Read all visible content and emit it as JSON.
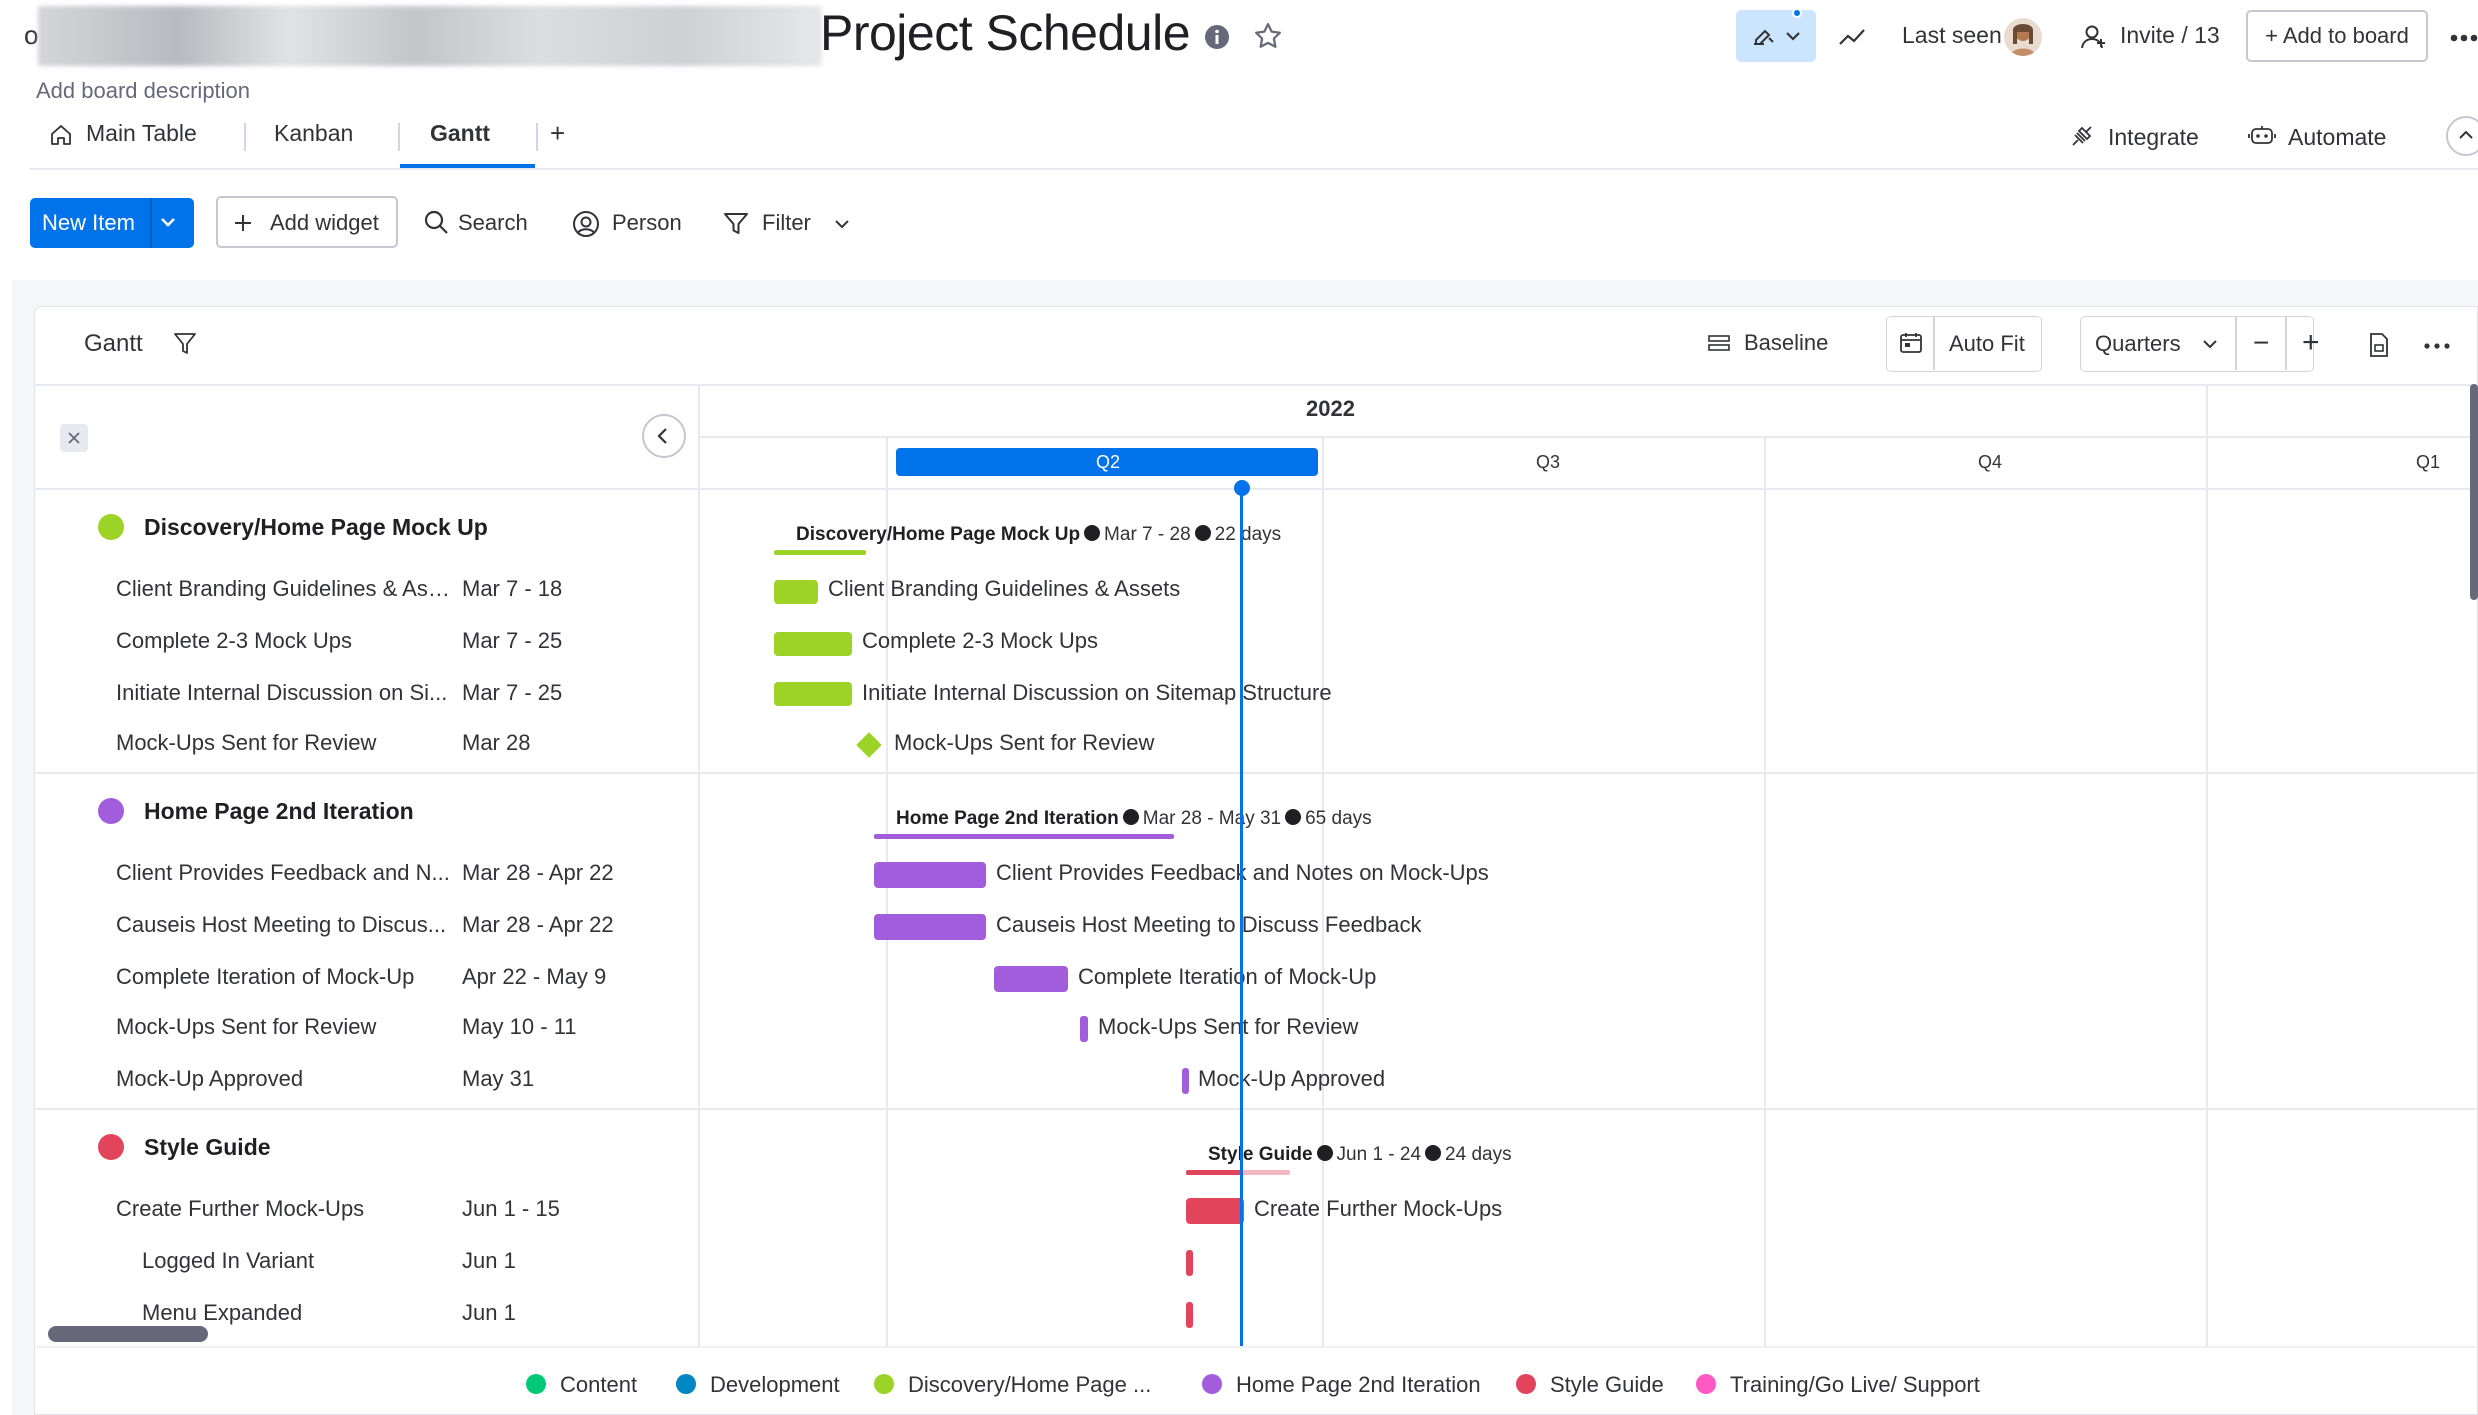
{
  "header": {
    "cut_letter": "o",
    "title": "Project Schedule",
    "last_seen_label": "Last seen",
    "invite_label": "Invite / 13",
    "add_to_board_label": "+ Add to board",
    "description_placeholder": "Add board description"
  },
  "tabs": [
    {
      "label": "Main Table",
      "active": false
    },
    {
      "label": "Kanban",
      "active": false
    },
    {
      "label": "Gantt",
      "active": true
    }
  ],
  "tab_add_label": "+",
  "right_actions": {
    "integrate": "Integrate",
    "automate": "Automate"
  },
  "toolbar": {
    "new_item": "New Item",
    "add_widget": "Add widget",
    "search": "Search",
    "person": "Person",
    "filter": "Filter"
  },
  "gantt_header": {
    "title": "Gantt",
    "baseline": "Baseline",
    "auto_fit": "Auto Fit",
    "zoom_select": "Quarters",
    "zoom_out": "−",
    "zoom_in": "+"
  },
  "timeline": {
    "year": "2022",
    "quarters": [
      "Q2",
      "Q3",
      "Q4",
      "Q1"
    ],
    "active_quarter": "Q2"
  },
  "groups": [
    {
      "name": "Discovery/Home Page Mock Up",
      "color": "#9cd326",
      "summary": {
        "name": "Discovery/Home Page Mock Up",
        "range": "Mar 7 - 28",
        "duration": "22 days"
      },
      "tasks": [
        {
          "name": "Client Branding Guidelines & Assets",
          "display_name": "Client Branding Guidelines & Ass...",
          "dates": "Mar 7 - 18",
          "type": "bar"
        },
        {
          "name": "Complete 2-3 Mock Ups",
          "display_name": "Complete 2-3 Mock Ups",
          "dates": "Mar 7 - 25",
          "type": "bar"
        },
        {
          "name": "Initiate Internal Discussion on Sitemap Structure",
          "display_name": "Initiate Internal Discussion on Si...",
          "dates": "Mar 7 - 25",
          "type": "bar"
        },
        {
          "name": "Mock-Ups Sent for Review",
          "display_name": "Mock-Ups Sent for Review",
          "dates": "Mar 28",
          "type": "milestone"
        }
      ]
    },
    {
      "name": "Home Page 2nd Iteration",
      "color": "#a25ddc",
      "summary": {
        "name": "Home Page 2nd Iteration",
        "range": "Mar 28 - May 31",
        "duration": "65 days"
      },
      "tasks": [
        {
          "name": "Client Provides Feedback and Notes on Mock-Ups",
          "display_name": "Client Provides Feedback and N...",
          "dates": "Mar 28 - Apr 22",
          "type": "bar"
        },
        {
          "name": "Causeis Host Meeting to Discuss Feedback",
          "display_name": "Causeis Host Meeting to Discus...",
          "dates": "Mar 28 - Apr 22",
          "type": "bar"
        },
        {
          "name": "Complete Iteration of Mock-Up",
          "display_name": "Complete Iteration of Mock-Up",
          "dates": "Apr 22 - May 9",
          "type": "bar"
        },
        {
          "name": "Mock-Ups Sent for Review",
          "display_name": "Mock-Ups Sent for Review",
          "dates": "May 10 - 11",
          "type": "bar"
        },
        {
          "name": "Mock-Up Approved",
          "display_name": "Mock-Up Approved",
          "dates": "May 31",
          "type": "bar"
        }
      ]
    },
    {
      "name": "Style Guide",
      "color": "#e2445c",
      "summary": {
        "name": "Style Guide",
        "range": "Jun 1 - 24",
        "duration": "24 days"
      },
      "tasks": [
        {
          "name": "Create Further Mock-Ups",
          "display_name": "Create Further Mock-Ups",
          "dates": "Jun 1 - 15",
          "type": "bar",
          "label": "Create Further Mock-Ups"
        },
        {
          "name": "Logged In Variant",
          "display_name": "Logged In Variant",
          "dates": "Jun 1",
          "type": "bar",
          "indent": true
        },
        {
          "name": "Menu Expanded",
          "display_name": "Menu Expanded",
          "dates": "Jun 1",
          "type": "bar",
          "indent": true
        }
      ]
    }
  ],
  "legend": [
    {
      "label": "Content",
      "color": "#00c875"
    },
    {
      "label": "Development",
      "color": "#0086c0"
    },
    {
      "label": "Discovery/Home Page ...",
      "color": "#9cd326"
    },
    {
      "label": "Home Page 2nd Iteration",
      "color": "#a25ddc"
    },
    {
      "label": "Style Guide",
      "color": "#e2445c"
    },
    {
      "label": "Training/Go Live/ Support",
      "color": "#ff5ac4"
    }
  ],
  "colors": {
    "accent": "#0073ea",
    "today_line": "#0073ea"
  }
}
